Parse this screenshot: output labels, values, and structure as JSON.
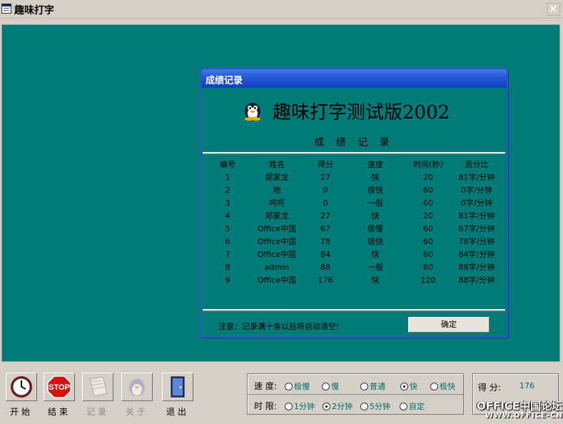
{
  "window": {
    "title": "趣味打字",
    "close_glyph": "✕"
  },
  "dialog": {
    "title": "成绩记录",
    "heading": "趣味打字测试版2002",
    "subheading": "成 绩 记 录",
    "columns": [
      "编号",
      "姓名",
      "得分",
      "速度",
      "时间(秒)",
      "百分比"
    ],
    "rows": [
      [
        "1",
        "郑家龙",
        "27",
        "快",
        "20",
        "81字/分钟"
      ],
      [
        "2",
        "地",
        "0",
        "极快",
        "60",
        "0字/分钟"
      ],
      [
        "3",
        "呵呵",
        "0",
        "一般",
        "60",
        "0字/分钟"
      ],
      [
        "4",
        "郑家龙",
        "27",
        "快",
        "20",
        "81字/分钟"
      ],
      [
        "5",
        "Office中国",
        "67",
        "极慢",
        "60",
        "67字/分钟"
      ],
      [
        "6",
        "Office中国",
        "78",
        "极快",
        "60",
        "78字/分钟"
      ],
      [
        "7",
        "Office中国",
        "84",
        "快",
        "60",
        "84字/分钟"
      ],
      [
        "8",
        "admin",
        "88",
        "一般",
        "60",
        "88字/分钟"
      ],
      [
        "9",
        "Office中国",
        "176",
        "快",
        "120",
        "88字/分钟"
      ]
    ],
    "notice": "注意：记录满十条以后将自动清空!",
    "ok_label": "确定"
  },
  "toolbar": {
    "start_label": "开始",
    "stop_label": "结束",
    "record_label": "记录",
    "about_label": "关于",
    "exit_label": "退出",
    "stop_sign_text": "STOP"
  },
  "speed": {
    "label": "速 度:",
    "options": [
      "极慢",
      "慢",
      "普通",
      "快",
      "极快"
    ],
    "selected": "快"
  },
  "time_limit": {
    "label": "时 限:",
    "options": [
      "1分钟",
      "2分钟",
      "5分钟",
      "自定"
    ],
    "selected": "2分钟"
  },
  "score": {
    "label": "得    分:",
    "value": "176"
  },
  "watermark": {
    "line1": "OFFICE中国论坛",
    "line2": "WWW.OFFICE-CN.NET"
  },
  "colors": {
    "teal": "#007b77",
    "dialog_title_blue": "#2457d6",
    "face": "#d4d0c8"
  }
}
